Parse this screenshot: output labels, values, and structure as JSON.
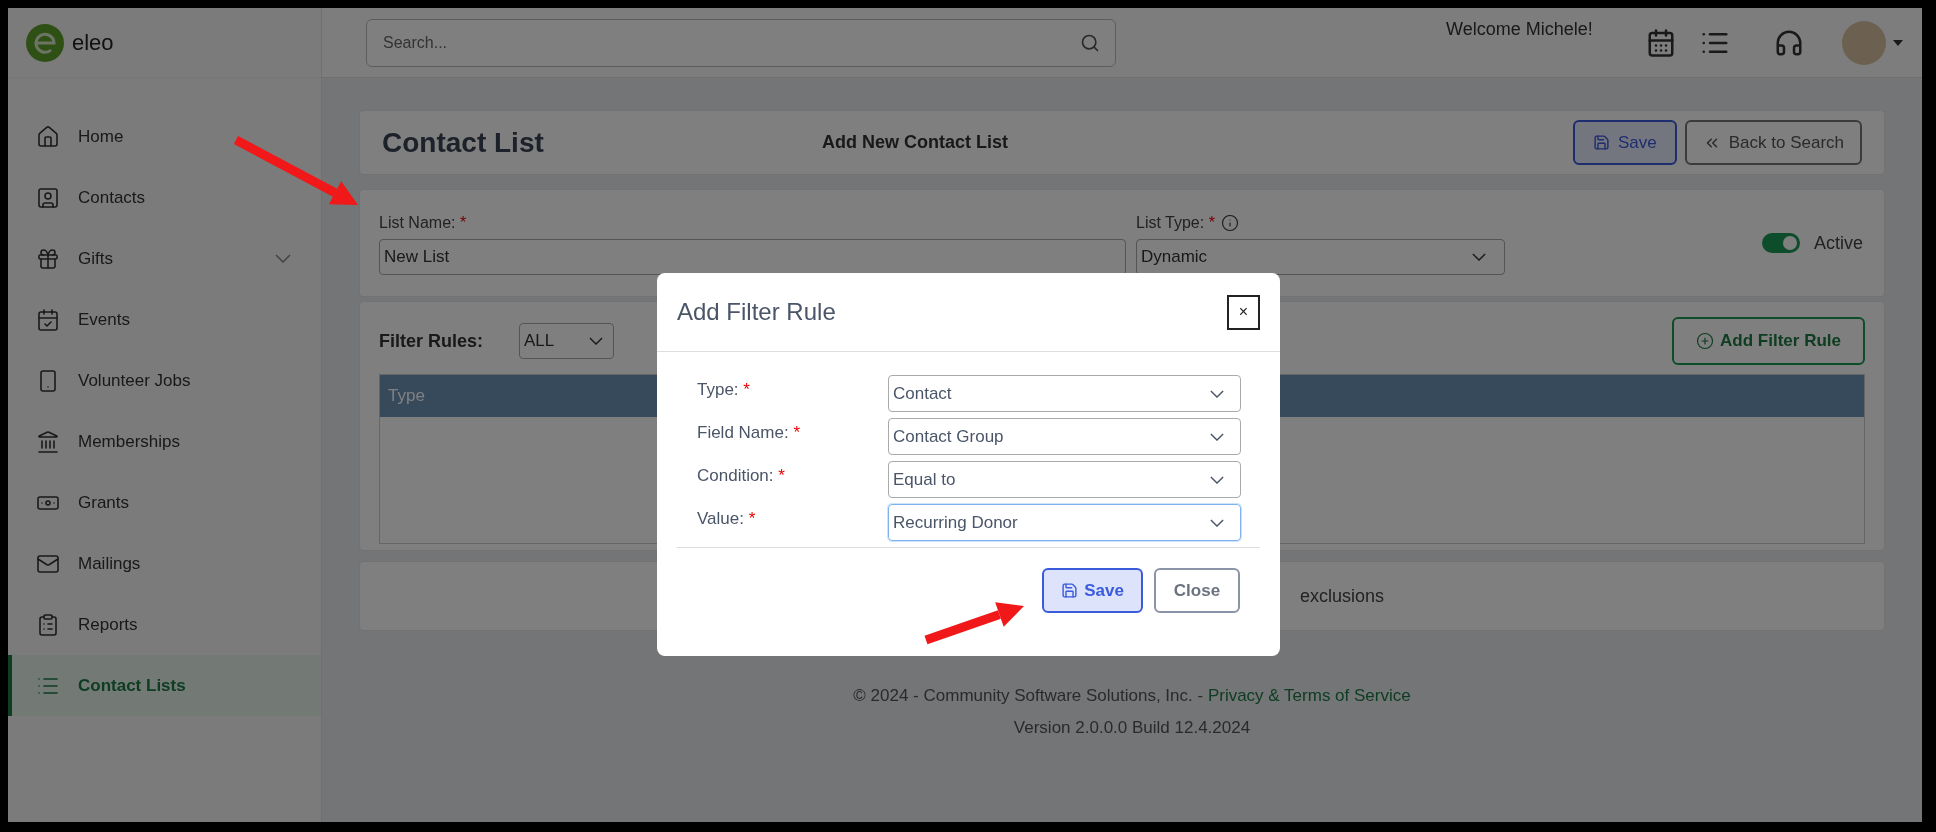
{
  "sidebar": {
    "logo_text": "eleo",
    "items": [
      {
        "label": "Home",
        "selected": false,
        "expandable": false
      },
      {
        "label": "Contacts",
        "selected": false,
        "expandable": false
      },
      {
        "label": "Gifts",
        "selected": false,
        "expandable": true
      },
      {
        "label": "Events",
        "selected": false,
        "expandable": false
      },
      {
        "label": "Volunteer Jobs",
        "selected": false,
        "expandable": false
      },
      {
        "label": "Memberships",
        "selected": false,
        "expandable": false
      },
      {
        "label": "Grants",
        "selected": false,
        "expandable": false
      },
      {
        "label": "Mailings",
        "selected": false,
        "expandable": false
      },
      {
        "label": "Reports",
        "selected": false,
        "expandable": false
      },
      {
        "label": "Contact Lists",
        "selected": true,
        "expandable": false
      }
    ]
  },
  "header": {
    "search": {
      "placeholder": "Search..."
    },
    "welcome": "Welcome Michele!"
  },
  "page": {
    "title": "Contact List",
    "subtitle": "Add New Contact List",
    "save_button": "Save",
    "back_button": "Back to Search"
  },
  "form": {
    "list_name": {
      "label": "List Name:",
      "required_mark": "*",
      "value": "New List"
    },
    "list_type": {
      "label": "List Type:",
      "required_mark": "*",
      "value": "Dynamic"
    },
    "active": {
      "label": "Active",
      "on": true
    }
  },
  "filter": {
    "label": "Filter Rules:",
    "match": "ALL",
    "add_button": "Add Filter Rule",
    "table": {
      "columns": [
        "Type"
      ]
    }
  },
  "exclusions_text": "exclusions",
  "footer": {
    "copyright": "© 2024 - Community Software Solutions, Inc. -",
    "link": "Privacy & Terms of Service",
    "version": "Version 2.0.0.0 Build 12.4.2024"
  },
  "modal": {
    "title": "Add Filter Rule",
    "close_icon": "×",
    "fields": [
      {
        "label": "Type:",
        "required_mark": "*",
        "value": "Contact",
        "focused": false
      },
      {
        "label": "Field Name:",
        "required_mark": "*",
        "value": "Contact Group",
        "focused": false
      },
      {
        "label": "Condition:",
        "required_mark": "*",
        "value": "Equal to",
        "focused": false
      },
      {
        "label": "Value:",
        "required_mark": "*",
        "value": "Recurring Donor",
        "focused": true
      }
    ],
    "save_button": "Save",
    "close_button": "Close"
  }
}
